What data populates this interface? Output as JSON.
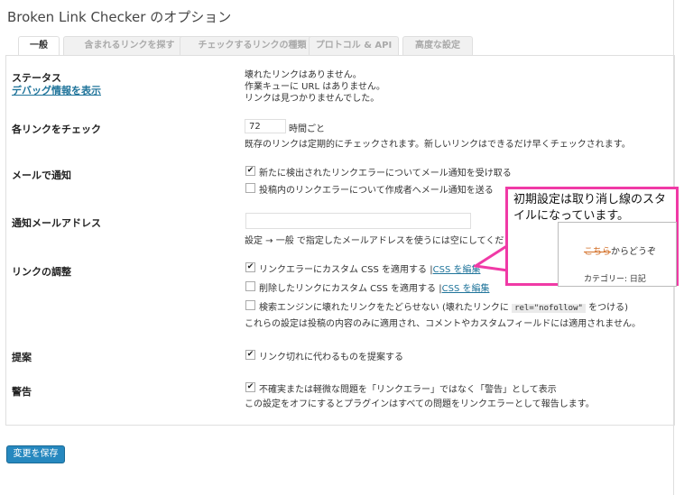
{
  "page": {
    "title": "Broken Link Checker のオプション"
  },
  "tabs": [
    {
      "label": "一般"
    },
    {
      "label": "含まれるリンクを探す"
    },
    {
      "label": "チェックするリンクの種類"
    },
    {
      "label": "プロトコル & API"
    },
    {
      "label": "高度な設定"
    }
  ],
  "status": {
    "label": "ステータス",
    "debug_link": "デバッグ情報を表示",
    "line1": "壊れたリンクはありません。",
    "line2": "作業キューに URL はありません。",
    "line3": "リンクは見つかりませんでした。"
  },
  "check_each": {
    "label": "各リンクをチェック",
    "value": "72",
    "unit": "時間ごと",
    "note": "既存のリンクは定期的にチェックされます。新しいリンクはできるだけ早くチェックされます。"
  },
  "email": {
    "label": "メールで通知",
    "opt1": "新たに検出されたリンクエラーについてメール通知を受け取る",
    "opt1_checked": true,
    "opt2": "投稿内のリンクエラーについて作成者へメール通知を送る",
    "opt2_checked": false
  },
  "notify_email": {
    "label": "通知メールアドレス",
    "value": "",
    "note": "設定 → 一般 で指定したメールアドレスを使うには空にしてください。"
  },
  "adjust": {
    "label": "リンクの調整",
    "opt1": "リンクエラーにカスタム CSS を適用する",
    "opt1_checked": true,
    "opt2": "削除したリンクにカスタム CSS を適用する",
    "opt2_checked": false,
    "edit_css": "CSS を編集",
    "sep": "|",
    "opt3_pre": "検索エンジンに壊れたリンクをたどらせない (壊れたリンクに",
    "opt3_code": "rel=\"nofollow\"",
    "opt3_post": "をつける)",
    "opt3_checked": false,
    "note": "これらの設定は投稿の内容のみに適用され、コメントやカスタムフィールドには適用されません。"
  },
  "suggest": {
    "label": "提案",
    "opt": "リンク切れに代わるものを提案する",
    "checked": true
  },
  "warning": {
    "label": "警告",
    "opt": "不確実または軽微な問題を「リンクエラー」ではなく「警告」として表示",
    "checked": true,
    "note": "この設定をオフにするとプラグインはすべての問題をリンクエラーとして報告します。"
  },
  "save_button": "変更を保存",
  "callout": {
    "text": "初期設定は取り消し線のスタイルになっています。",
    "strike_text": "こちら",
    "rest_text": "からどうぞ",
    "category_text": "カテゴリー: 日記",
    "color": "#f03aa6"
  },
  "checkmark": "✔"
}
